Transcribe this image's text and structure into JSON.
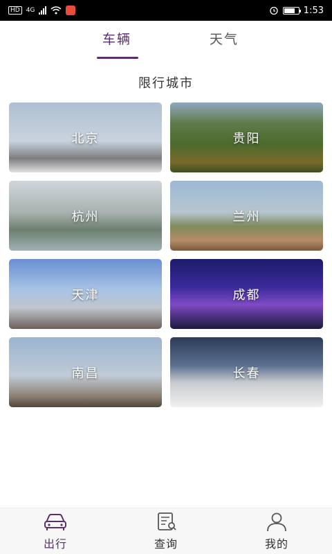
{
  "status_bar": {
    "left_badges": [
      "HD",
      "4G"
    ],
    "time": "1:53"
  },
  "tabs": [
    {
      "label": "车辆",
      "active": true
    },
    {
      "label": "天气",
      "active": false
    }
  ],
  "section_title": "限行城市",
  "cities": [
    {
      "name": "北京"
    },
    {
      "name": "贵阳"
    },
    {
      "name": "杭州"
    },
    {
      "name": "兰州"
    },
    {
      "name": "天津"
    },
    {
      "name": "成都"
    },
    {
      "name": "南昌"
    },
    {
      "name": "长春"
    }
  ],
  "bottom_nav": [
    {
      "label": "出行",
      "icon": "car-icon",
      "active": true
    },
    {
      "label": "查询",
      "icon": "search-document-icon",
      "active": false
    },
    {
      "label": "我的",
      "icon": "user-icon",
      "active": false
    }
  ],
  "colors": {
    "accent": "#5a2f6b",
    "status_bar": "#000000"
  }
}
